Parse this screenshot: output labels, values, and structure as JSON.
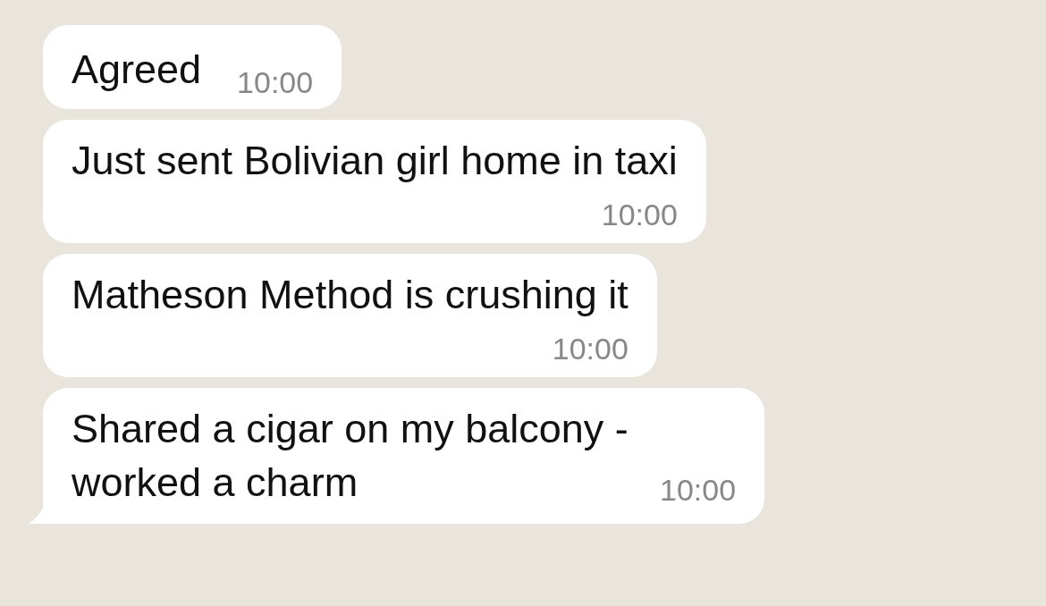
{
  "messages": [
    {
      "kind": "inline",
      "text": "Agreed",
      "time": "10:00",
      "tail": false
    },
    {
      "kind": "stacked",
      "text": "Just sent Bolivian girl home in taxi",
      "time": "10:00",
      "tail": false
    },
    {
      "kind": "stacked",
      "text": "Matheson Method is crushing it",
      "time": "10:00",
      "tail": false
    },
    {
      "kind": "wrapped",
      "text": "Shared a cigar on my balcony - worked a charm",
      "time": "10:00",
      "tail": true
    }
  ]
}
